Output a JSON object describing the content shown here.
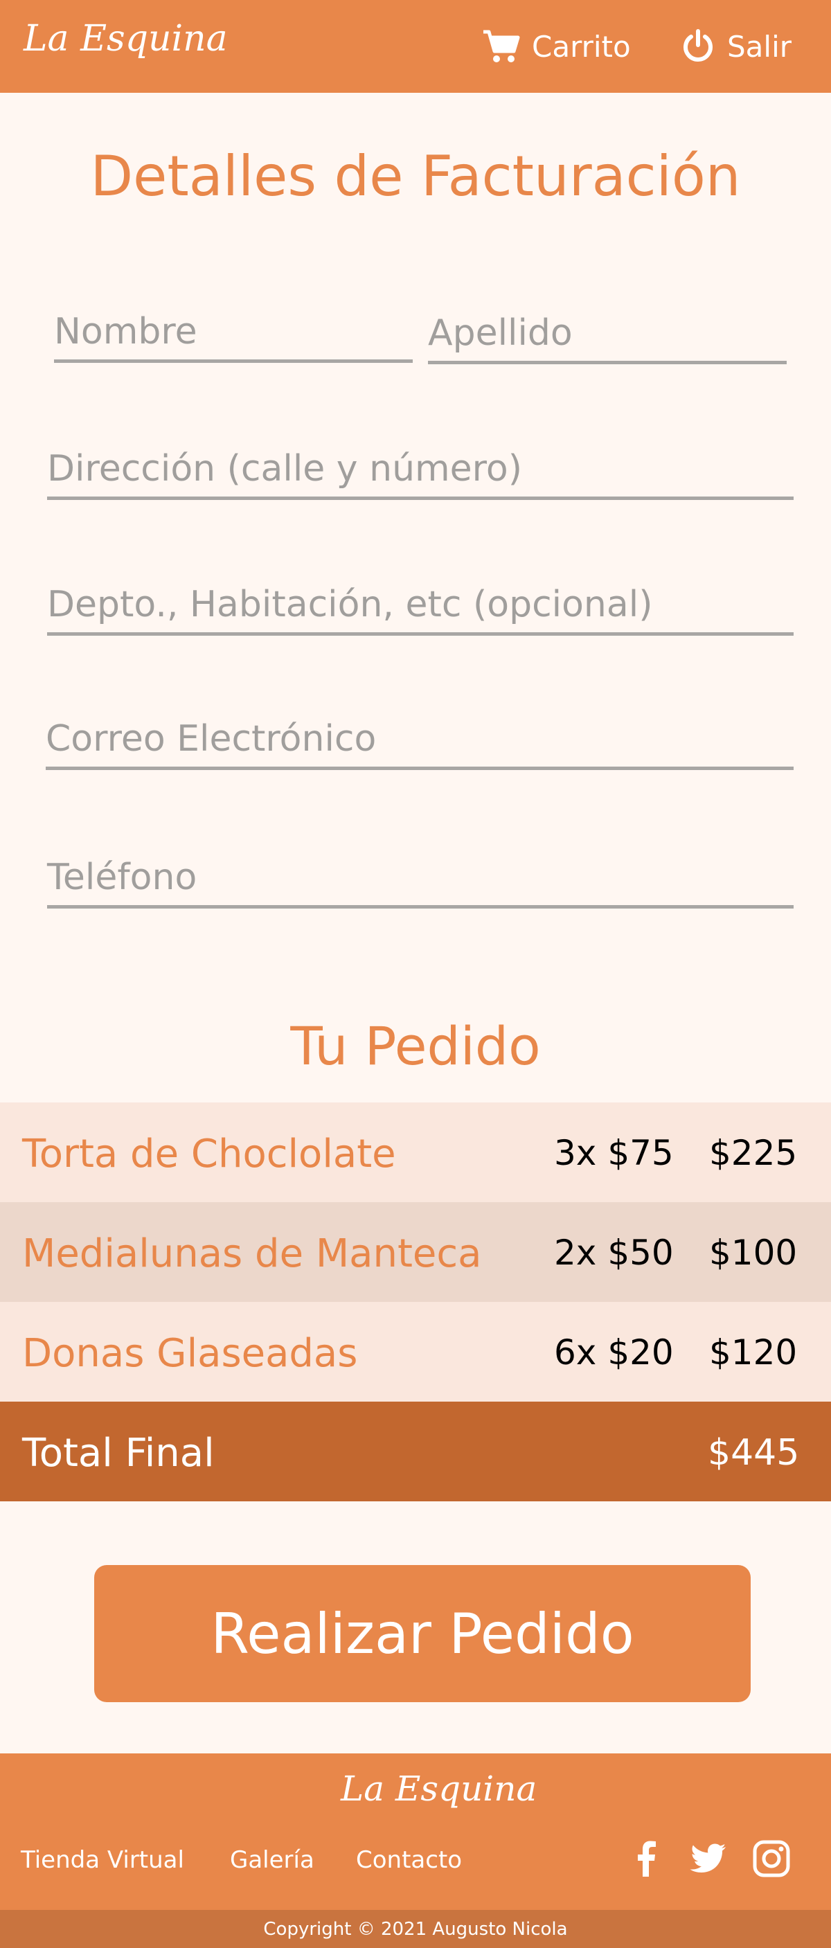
{
  "brand": {
    "name": "La Esquina",
    "color": "#e8874a",
    "dark_color": "#c2672f"
  },
  "header": {
    "cart_label": "Carrito",
    "cart_icon": "cart-icon",
    "logout_label": "Salir",
    "logout_icon": "power-icon"
  },
  "billing": {
    "title": "Detalles de Facturación",
    "fields": {
      "first_name": {
        "placeholder": "Nombre",
        "value": ""
      },
      "last_name": {
        "placeholder": "Apellido",
        "value": ""
      },
      "address": {
        "placeholder": "Dirección (calle y número)",
        "value": ""
      },
      "apartment": {
        "placeholder": "Depto., Habitación, etc (opcional)",
        "value": ""
      },
      "email": {
        "placeholder": "Correo Electrónico",
        "value": ""
      },
      "phone": {
        "placeholder": "Teléfono",
        "value": ""
      }
    }
  },
  "order": {
    "title": "Tu Pedido",
    "items": [
      {
        "name": "Torta de Choclolate",
        "qty": "3x",
        "unit_price": "$75",
        "total": "$225"
      },
      {
        "name": "Medialunas de Manteca",
        "qty": "2x",
        "unit_price": "$50",
        "total": "$100"
      },
      {
        "name": "Donas Glaseadas",
        "qty": "6x",
        "unit_price": "$20",
        "total": "$120"
      }
    ],
    "total_label": "Total Final",
    "total_value": "$445"
  },
  "actions": {
    "place_order_label": "Realizar Pedido"
  },
  "footer": {
    "links": [
      "Tienda Virtual",
      "Galería",
      "Contacto"
    ],
    "social_icons": [
      "facebook-icon",
      "twitter-icon",
      "instagram-icon"
    ],
    "copyright": "Copyright © 2021 Augusto Nicola"
  }
}
